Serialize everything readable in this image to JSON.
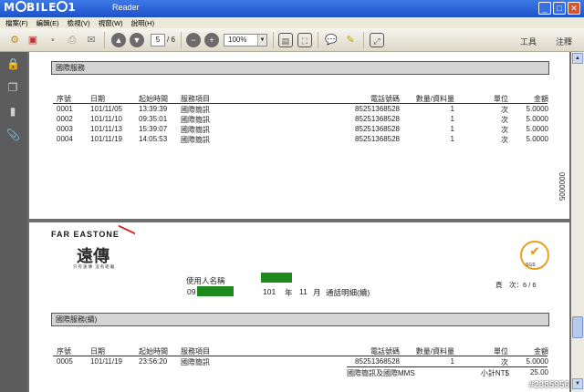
{
  "window": {
    "logo": "MOBILE01",
    "title": "Reader",
    "controls": [
      "minimize",
      "maximize",
      "close"
    ]
  },
  "menu": [
    "檔案(F)",
    "編輯(E)",
    "檢視(V)",
    "視窗(W)",
    "說明(H)"
  ],
  "toolbar": {
    "page_current": "5",
    "page_total": "/ 6",
    "zoom": "100%",
    "tools_label": "工具",
    "comment_label": "注釋"
  },
  "page1": {
    "section_title": "國際服務",
    "headers": [
      "序號",
      "日期",
      "起始時間",
      "服務項目",
      "電話號碼",
      "數量/資料量",
      "單位",
      "金額"
    ],
    "rows": [
      [
        "0001",
        "101/11/05",
        "13:39:39",
        "國際簡訊",
        "85251368528",
        "1",
        "次",
        "5.0000"
      ],
      [
        "0002",
        "101/11/10",
        "09:35:01",
        "國際簡訊",
        "85251368528",
        "1",
        "次",
        "5.0000"
      ],
      [
        "0003",
        "101/11/13",
        "15:39:07",
        "國際簡訊",
        "85251368528",
        "1",
        "次",
        "5.0000"
      ],
      [
        "0004",
        "101/11/19",
        "14:05:53",
        "國際簡訊",
        "85251368528",
        "1",
        "次",
        "5.0000"
      ]
    ],
    "vertical_code": "0000005"
  },
  "page2": {
    "brand": "FAR EASTONE",
    "brand_cn": "遠傳",
    "brand_tagline": "只有遠傳 沒有距離",
    "sgs_label": "SGS",
    "user_name_label": "使用人名稱",
    "phone_prefix": "09",
    "year": "101",
    "year_label": "年",
    "month": "11",
    "month_label": "月",
    "detail_title": "通話明細(續)",
    "page_label": "頁　次：6 / 6",
    "section_title": "國際服務(續)",
    "headers": [
      "序號",
      "日期",
      "起始時間",
      "服務項目",
      "電話號碼",
      "數量/資料量",
      "單位",
      "金額"
    ],
    "rows": [
      [
        "0005",
        "101/11/19",
        "23:56:20",
        "國際簡訊",
        "85251368528",
        "1",
        "次",
        "5.0000"
      ]
    ],
    "subtotal_desc": "國際簡訊及國際MMS",
    "subtotal_label": "小計NT$",
    "subtotal_value": "25.00"
  },
  "watermark": "#2385956",
  "colors": {
    "title_bar": "#1d52c8",
    "redaction": "#1e8a1e",
    "brand_red": "#d42020",
    "sgs_orange": "#e8a020"
  }
}
